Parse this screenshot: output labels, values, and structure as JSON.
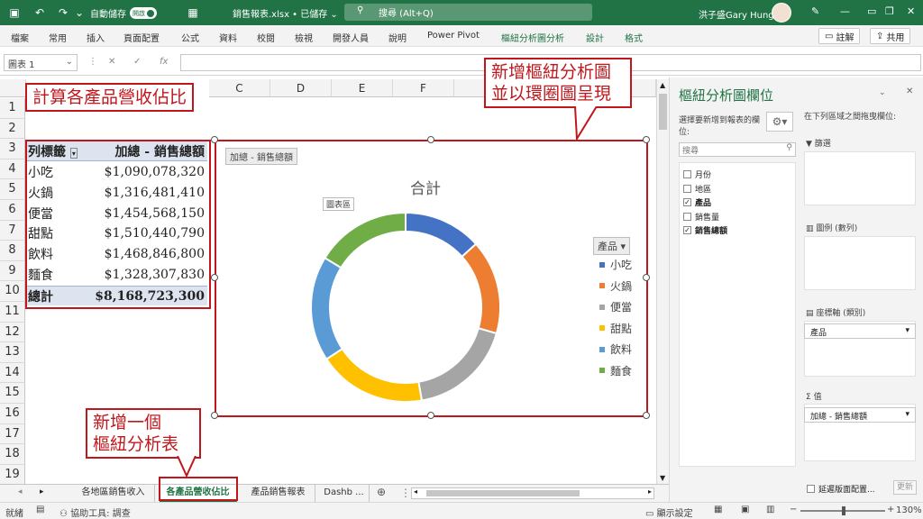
{
  "titlebar": {
    "autosave_label": "自動儲存",
    "autosave_state": "開啟",
    "filename": "銷售報表.xlsx • 已儲存 ⌄",
    "search": "搜尋 (Alt+Q)",
    "user": "洪子盛Gary Hung"
  },
  "ribbon": {
    "tabs": [
      "檔案",
      "常用",
      "插入",
      "頁面配置",
      "公式",
      "資料",
      "校閱",
      "檢視",
      "開發人員",
      "說明",
      "Power Pivot",
      "樞紐分析圖分析",
      "設計",
      "格式"
    ],
    "comments": "註解",
    "share": "共用"
  },
  "formula_bar": {
    "name_box": "圖表 1"
  },
  "columns": [
    "C",
    "D",
    "E",
    "F"
  ],
  "rows": [
    "1",
    "2",
    "3",
    "4",
    "5",
    "6",
    "7",
    "8",
    "9",
    "10",
    "11",
    "12",
    "13",
    "14",
    "15",
    "16",
    "17",
    "18",
    "19"
  ],
  "pivot": {
    "header": [
      "列標籤",
      "加總 - 銷售總額"
    ],
    "rows": [
      [
        "小吃",
        "$1,090,078,320"
      ],
      [
        "火鍋",
        "$1,316,481,410"
      ],
      [
        "便當",
        "$1,454,568,150"
      ],
      [
        "甜點",
        "$1,510,440,790"
      ],
      [
        "飲料",
        "$1,468,846,800"
      ],
      [
        "麵食",
        "$1,328,307,830"
      ]
    ],
    "total": [
      "總計",
      "$8,168,723,300"
    ]
  },
  "chart_data": {
    "type": "pie",
    "variant": "doughnut",
    "title": "合計",
    "value_field": "加總 - 銷售總額",
    "chart_area_tooltip": "圖表區",
    "legend_title": "產品",
    "legend_position": "right",
    "categories": [
      "小吃",
      "火鍋",
      "便當",
      "甜點",
      "飲料",
      "麵食"
    ],
    "values": [
      1090078320,
      1316481410,
      1454568150,
      1510440790,
      1468846800,
      1328307830
    ],
    "colors": [
      "#4472c4",
      "#ed7d31",
      "#a5a5a5",
      "#ffc000",
      "#5b9bd5",
      "#70ad47"
    ]
  },
  "callouts": {
    "calc": "計算各產品營收佔比",
    "new_chart_1": "新增樞紐分析圖",
    "new_chart_2": "並以環圈圖呈現",
    "new_table_1": "新增一個",
    "new_table_2": "樞紐分析表"
  },
  "sheets": [
    "各地區銷售收入",
    "各產品營收佔比",
    "產品銷售報表",
    "Dashb ..."
  ],
  "status": {
    "ready": "就緒",
    "accessibility": "協助工具: 調查",
    "display": "顯示設定",
    "zoom": "130%"
  },
  "pane": {
    "title": "樞紐分析圖欄位",
    "choose": "選擇要新增到報表的欄位:",
    "drag": "在下列區域之間拖曳欄位:",
    "search": "搜尋",
    "fields": [
      {
        "name": "月份",
        "checked": false
      },
      {
        "name": "地區",
        "checked": false
      },
      {
        "name": "產品",
        "checked": true
      },
      {
        "name": "銷售量",
        "checked": false
      },
      {
        "name": "銷售總額",
        "checked": true
      }
    ],
    "filters": "篩選",
    "legend": "圖例 (數列)",
    "axis": "座標軸 (類別)",
    "axis_value": "產品",
    "values": "值",
    "values_value": "加總 - 銷售總額",
    "defer": "延遲版面配置...",
    "update": "更新"
  }
}
